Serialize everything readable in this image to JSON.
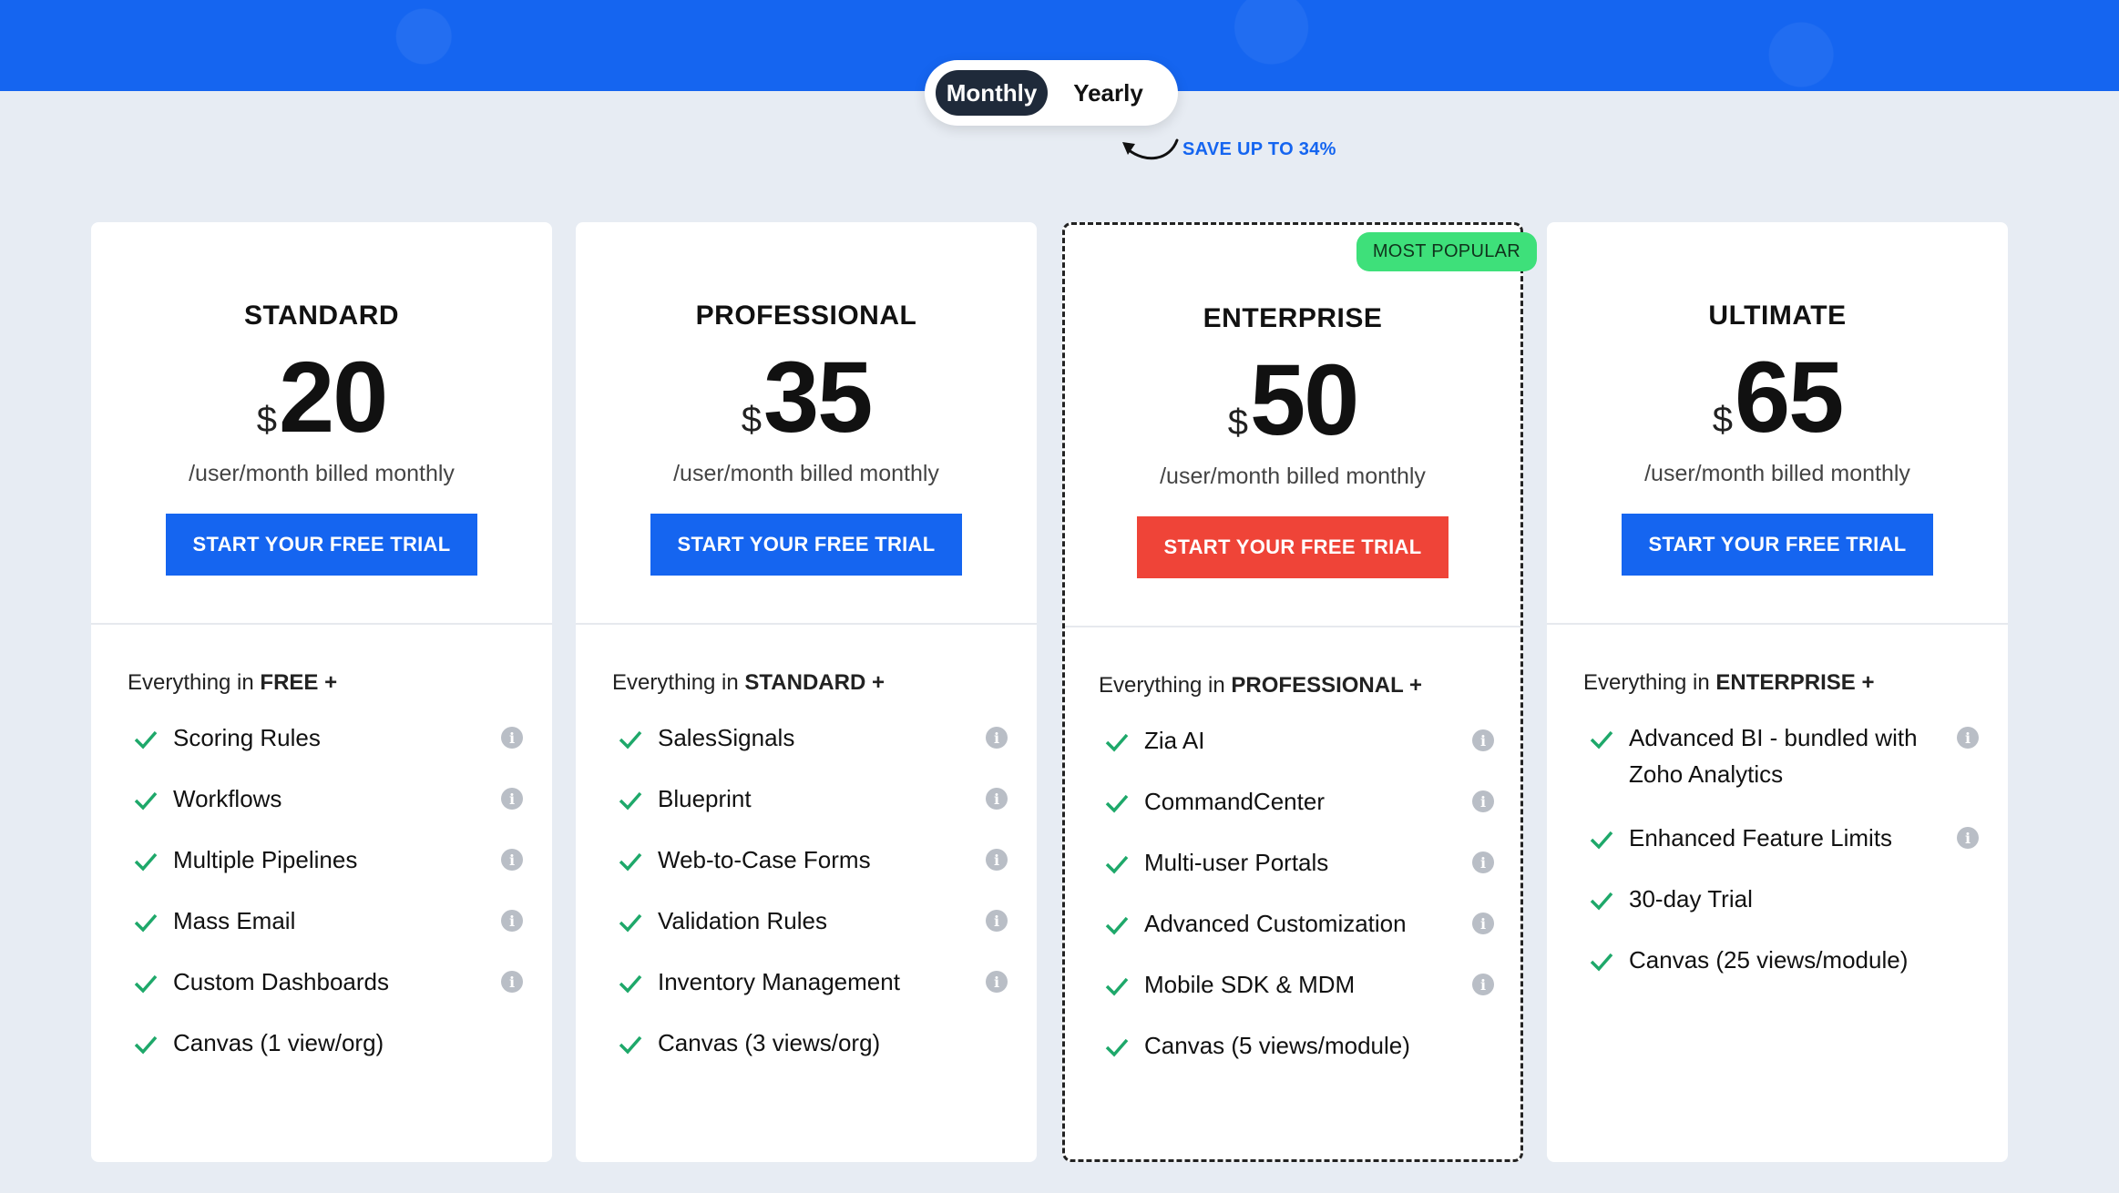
{
  "billing_toggle": {
    "monthly": "Monthly",
    "yearly": "Yearly"
  },
  "save_note": "SAVE UP TO 34%",
  "currency_symbol": "$",
  "plans": [
    {
      "name": "STANDARD",
      "price": "20",
      "billing": "/user/month billed monthly",
      "cta": "START YOUR FREE TRIAL",
      "everything_prefix": "Everything in ",
      "everything_plan": "FREE +",
      "features": [
        "Scoring Rules",
        "Workflows",
        "Multiple Pipelines",
        "Mass Email",
        "Custom Dashboards",
        "Canvas (1 view/org)"
      ]
    },
    {
      "name": "PROFESSIONAL",
      "price": "35",
      "billing": "/user/month billed monthly",
      "cta": "START YOUR FREE TRIAL",
      "everything_prefix": "Everything in ",
      "everything_plan": "STANDARD +",
      "features": [
        "SalesSignals",
        "Blueprint",
        "Web-to-Case Forms",
        "Validation Rules",
        "Inventory Management",
        "Canvas (3 views/org)"
      ]
    },
    {
      "name": "ENTERPRISE",
      "price": "50",
      "billing": "/user/month billed monthly",
      "cta": "START YOUR FREE TRIAL",
      "everything_prefix": "Everything in ",
      "everything_plan": "PROFESSIONAL +",
      "badge": "MOST POPULAR",
      "features": [
        "Zia AI",
        "CommandCenter",
        "Multi-user Portals",
        "Advanced Customization",
        "Mobile SDK & MDM",
        "Canvas (5 views/module)"
      ]
    },
    {
      "name": "ULTIMATE",
      "price": "65",
      "billing": "/user/month billed monthly",
      "cta": "START YOUR FREE TRIAL",
      "everything_prefix": "Everything in ",
      "everything_plan": "ENTERPRISE +",
      "features": [
        "Advanced BI - bundled with Zoho Analytics",
        "Enhanced Feature Limits",
        "30-day Trial",
        "Canvas (25 views/module)"
      ]
    }
  ],
  "colors": {
    "brand_blue": "#1565f0",
    "cta_red": "#ef4438",
    "check_green": "#1ea86a",
    "badge_green": "#3ee07a"
  },
  "icons": {
    "check": "check-icon",
    "info": "info-icon"
  }
}
